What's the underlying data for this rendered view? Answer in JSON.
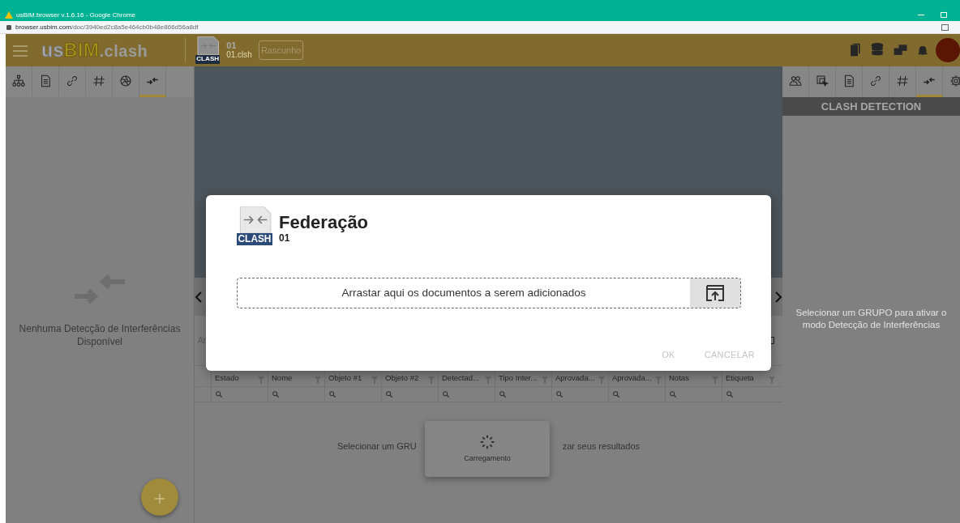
{
  "browser": {
    "title": "usBIM.browser v.1.6.16 - Google Chrome",
    "url_host": "browser.usbim.com",
    "url_path": "/doc/3940ed2c8a5e464cb0b48e866d56a8df"
  },
  "app_bar": {
    "logo_parts": [
      {
        "text": "us",
        "kind": "plain"
      },
      {
        "text": "BIM",
        "kind": "accent"
      },
      {
        "text": ".clash",
        "kind": "suffix"
      }
    ]
  },
  "document": {
    "type_label": "CLASH",
    "name": "01",
    "file": "01.clsh",
    "badge": "Rascunho"
  },
  "left_tabs": [
    {
      "kind": "hierarchy",
      "selected": false
    },
    {
      "kind": "document",
      "selected": false
    },
    {
      "kind": "link",
      "selected": false
    },
    {
      "kind": "hash",
      "selected": false
    },
    {
      "kind": "aperture",
      "selected": false
    },
    {
      "kind": "clash",
      "selected": true
    }
  ],
  "left_panel": {
    "empty_text": "Nenhuma Detecção de Interferências Disponível"
  },
  "table": {
    "toolbar_text": "Ar",
    "columns": [
      "Estado",
      "Nome",
      "Objeto #1",
      "Objeto #2",
      "Detectad...",
      "Tipo Inter...",
      "Aprovada...",
      "Aprovada...",
      "Notas",
      "Etiqueta"
    ],
    "empty_text_parts": [
      "Selecionar um GRU",
      "zar seus resultados"
    ]
  },
  "loading": {
    "text": "Carregamento"
  },
  "right_tabs": [
    {
      "kind": "users",
      "selected": false
    },
    {
      "kind": "select",
      "selected": false
    },
    {
      "kind": "document",
      "selected": false
    },
    {
      "kind": "link",
      "selected": false
    },
    {
      "kind": "hash",
      "selected": false
    },
    {
      "kind": "clash",
      "selected": true
    },
    {
      "kind": "gear",
      "selected": false
    }
  ],
  "right_panel": {
    "title": "CLASH DETECTION",
    "empty_text": "Selecionar um GRUPO para ativar o modo Detecção de Interferências"
  },
  "modal": {
    "file_label": "CLASH",
    "title": "Federação",
    "subtitle": "01",
    "dropzone_text": "Arrastar aqui os documentos a serem adicionados",
    "buttons": [
      {
        "label": "OK",
        "disabled": true
      },
      {
        "label": "CANCELAR",
        "disabled": true
      }
    ]
  }
}
